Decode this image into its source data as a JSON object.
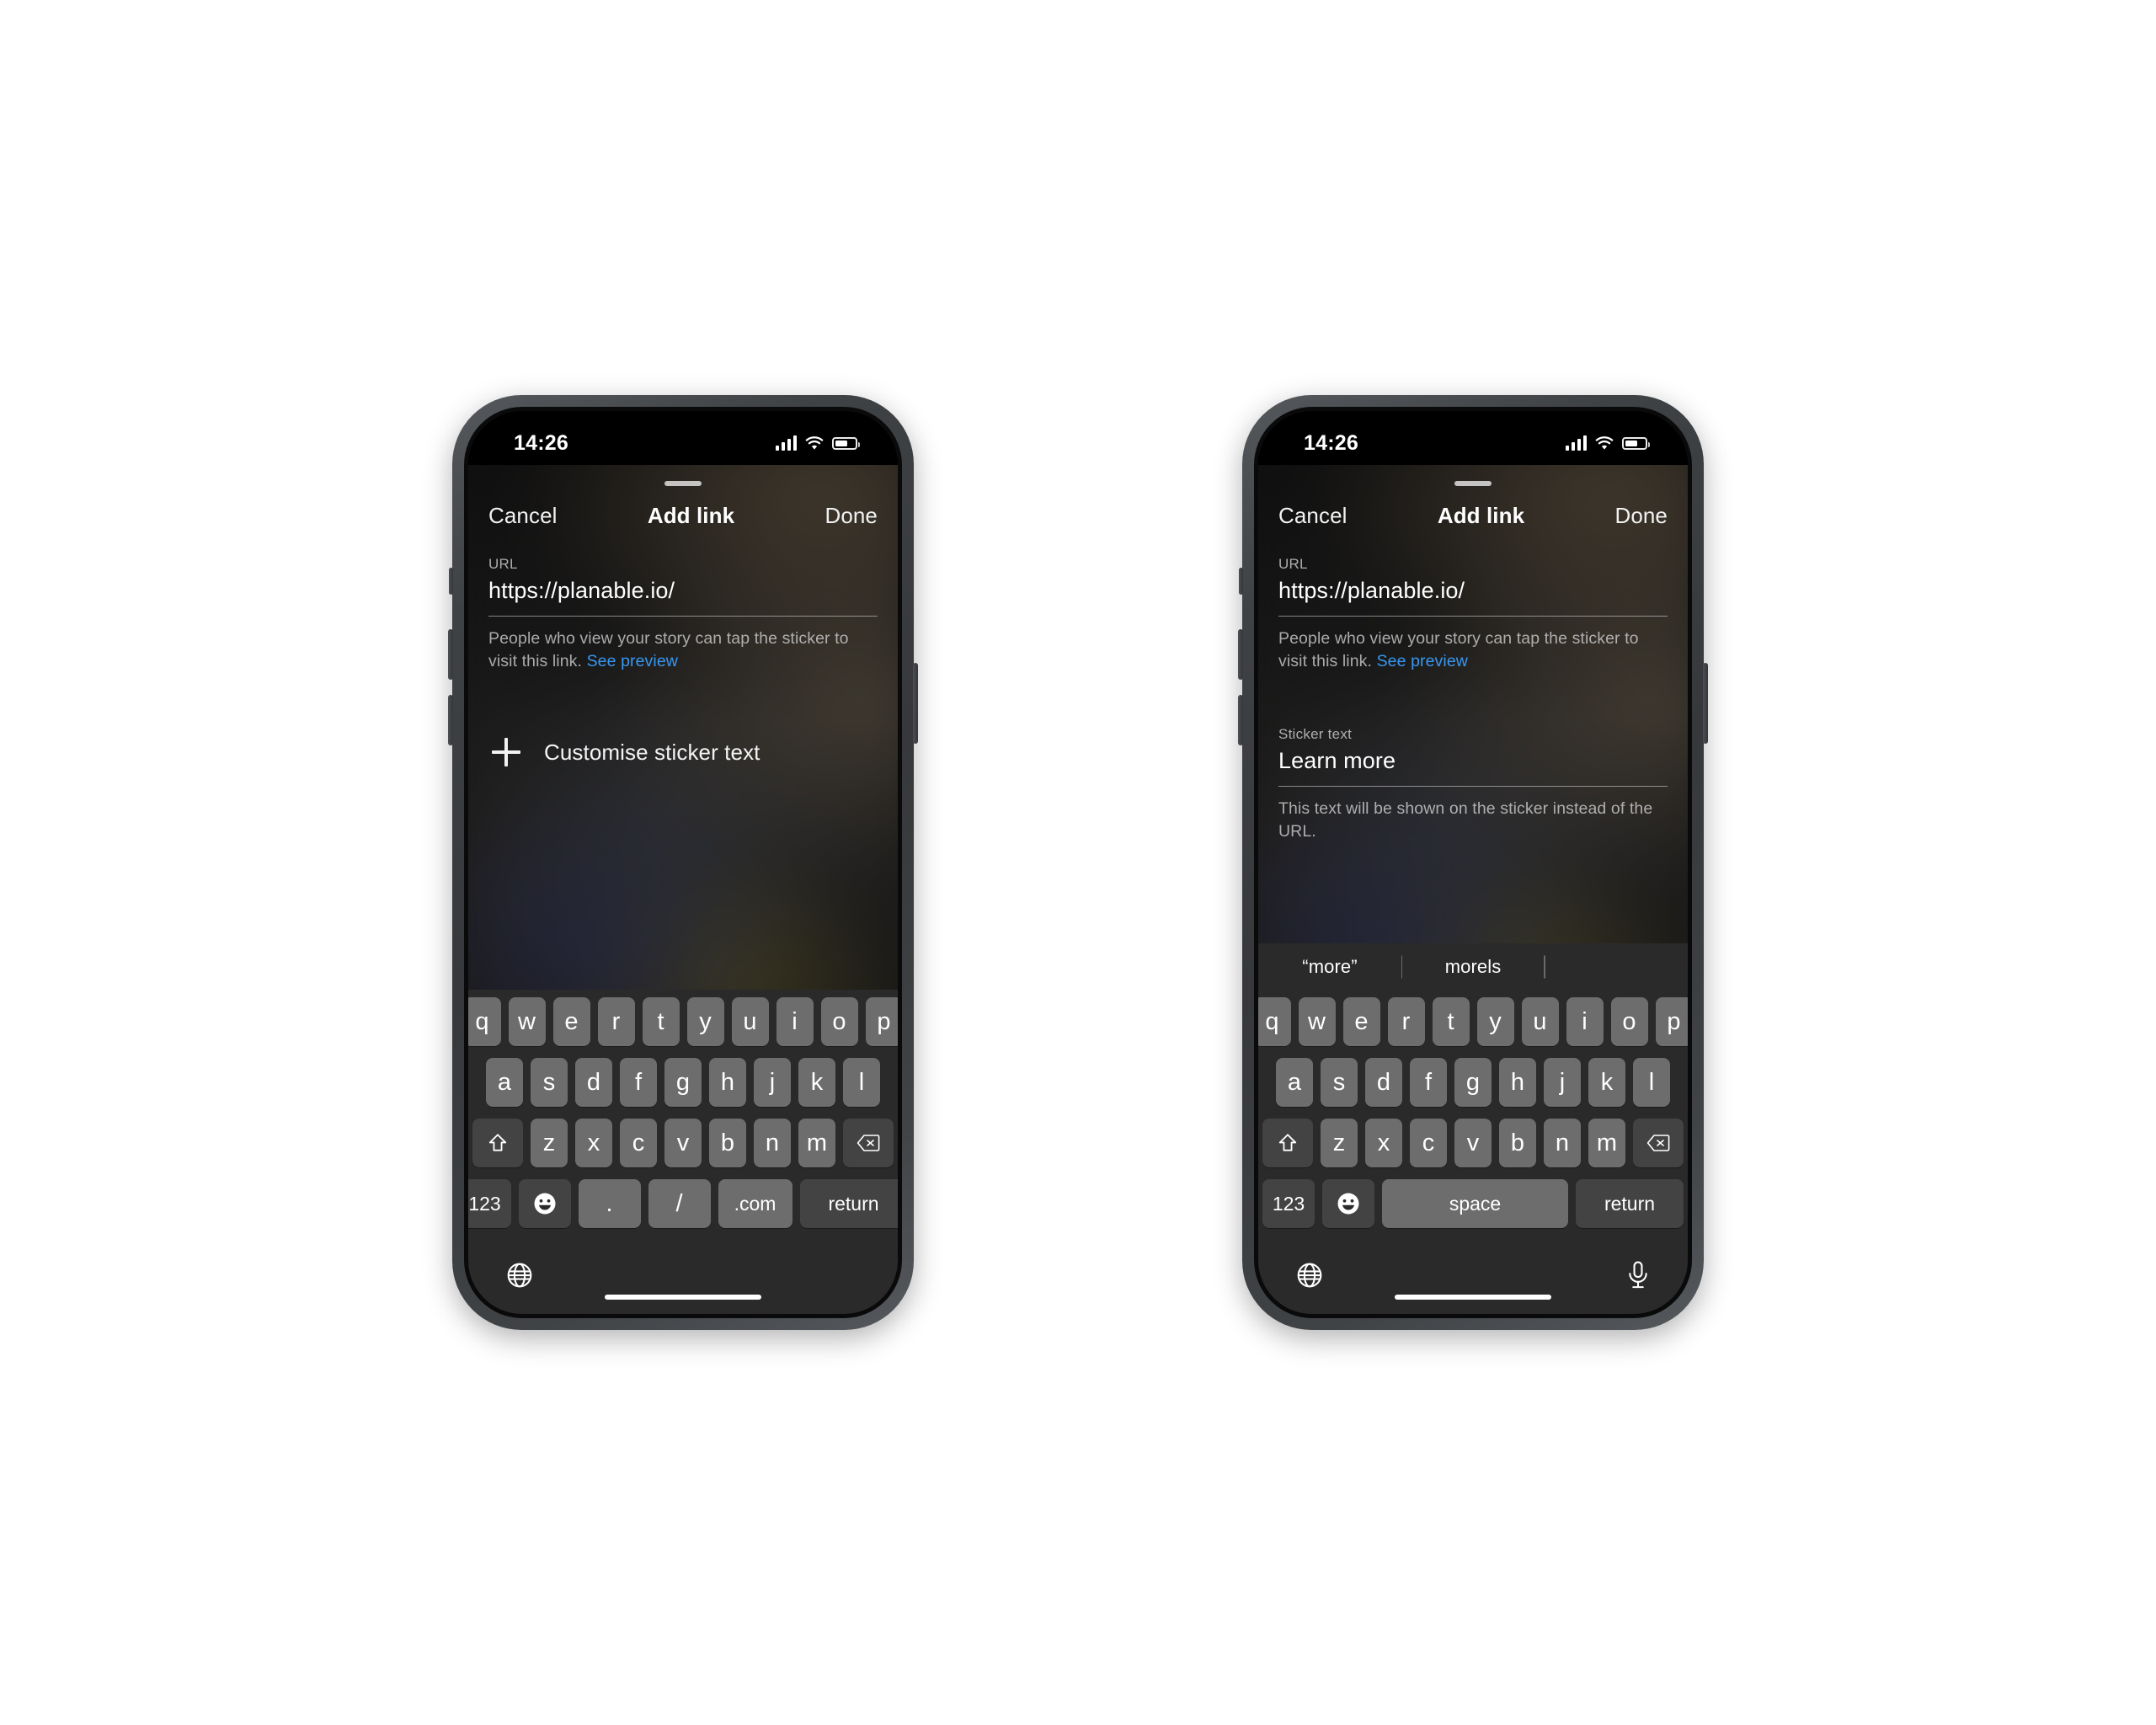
{
  "status_bar": {
    "time": "14:26",
    "cellular_icon": "cellular-signal-icon",
    "wifi_icon": "wifi-icon",
    "battery_icon": "battery-icon",
    "battery_level_pct": 62
  },
  "navbar": {
    "cancel_label": "Cancel",
    "title": "Add link",
    "done_label": "Done"
  },
  "url_field": {
    "label": "URL",
    "value": "https://planable.io/",
    "help_text": "People who view your story can tap the sticker to visit this link. ",
    "help_link": "See preview"
  },
  "left_phone": {
    "customise_row": {
      "icon": "plus-icon",
      "label": "Customise sticker text"
    },
    "keyboard": {
      "type": "url-keyboard",
      "rows": [
        [
          "q",
          "w",
          "e",
          "r",
          "t",
          "y",
          "u",
          "i",
          "o",
          "p"
        ],
        [
          "a",
          "s",
          "d",
          "f",
          "g",
          "h",
          "j",
          "k",
          "l"
        ],
        [
          "z",
          "x",
          "c",
          "v",
          "b",
          "n",
          "m"
        ]
      ],
      "shift_label": "shift-icon",
      "backspace_label": "backspace-icon",
      "numbers_label": "123",
      "emoji_label": "emoji-icon",
      "dot_label": ".",
      "slash_label": "/",
      "dotcom_label": ".com",
      "return_label": "return",
      "globe_label": "globe-icon"
    }
  },
  "right_phone": {
    "sticker_field": {
      "label": "Sticker text",
      "value": "Learn more",
      "help_text": "This text will be shown on the sticker instead of the URL."
    },
    "keyboard": {
      "type": "text-keyboard",
      "suggestions": [
        "“more”",
        "morels",
        ""
      ],
      "rows": [
        [
          "q",
          "w",
          "e",
          "r",
          "t",
          "y",
          "u",
          "i",
          "o",
          "p"
        ],
        [
          "a",
          "s",
          "d",
          "f",
          "g",
          "h",
          "j",
          "k",
          "l"
        ],
        [
          "z",
          "x",
          "c",
          "v",
          "b",
          "n",
          "m"
        ]
      ],
      "shift_label": "shift-icon",
      "backspace_label": "backspace-icon",
      "numbers_label": "123",
      "emoji_label": "emoji-icon",
      "space_label": "space",
      "return_label": "return",
      "globe_label": "globe-icon",
      "mic_label": "microphone-icon"
    }
  },
  "colors": {
    "accent_link": "#3897f0",
    "key_light": "#6d6d6d",
    "key_dark": "#434343",
    "keyboard_bg": "#2a2a2a",
    "frame": "#3f4245"
  }
}
